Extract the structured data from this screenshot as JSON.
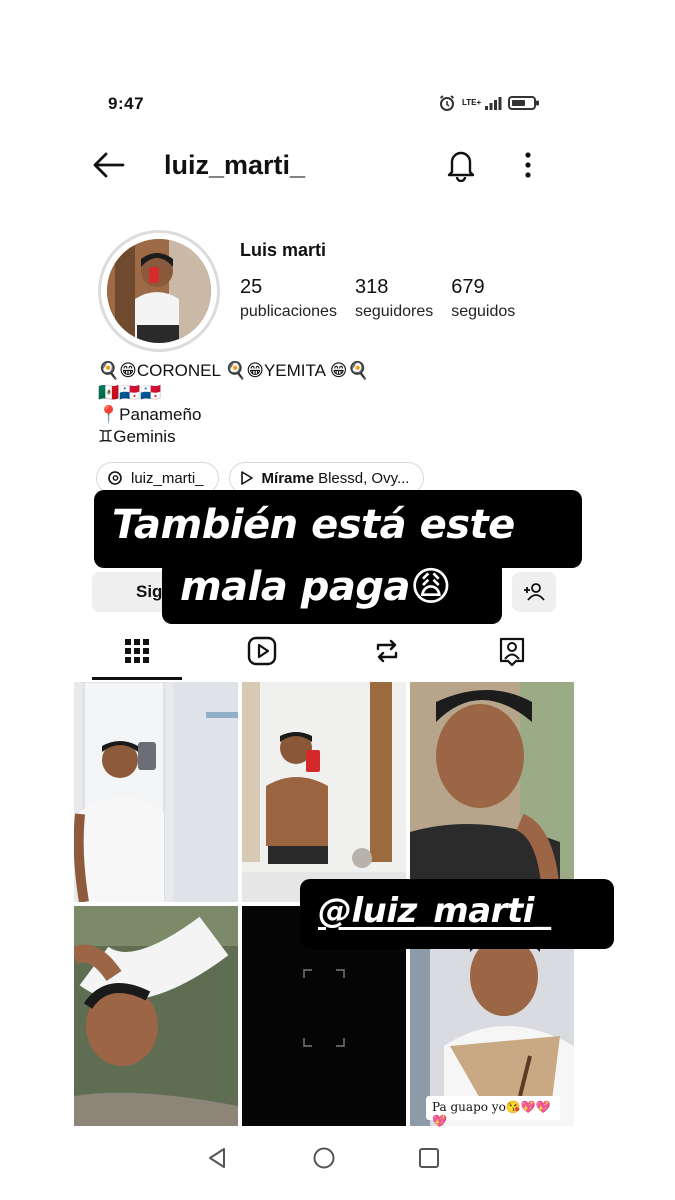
{
  "status_bar": {
    "time": "9:47",
    "network": "LTE+"
  },
  "header": {
    "username": "luiz_marti_"
  },
  "profile": {
    "name": "Luis marti",
    "stats": [
      {
        "value": "25",
        "label": "publicaciones"
      },
      {
        "value": "318",
        "label": "seguidores"
      },
      {
        "value": "679",
        "label": "seguidos"
      }
    ],
    "bio": {
      "line1": "🍳😁CORONEL 🍳😁YEMITA 😁🍳",
      "line2": "🇲🇽🇵🇦🇵🇦",
      "line3": "📍Panameño",
      "line4": "♊Geminis"
    }
  },
  "chips": {
    "threads_label": "luiz_marti_",
    "music_title": "Mírame",
    "music_artist": "Blessd, Ovy..."
  },
  "actions": {
    "follow_label": "Sig"
  },
  "tabs": [
    "grid",
    "reels",
    "reposts",
    "tagged"
  ],
  "overlay": {
    "caption_line1": "También está este",
    "caption_line2": "mala paga😩",
    "mention": "@luiz_marti_",
    "sticker": "Pa guapo yo😘💖💖💖"
  },
  "colors": {
    "caption_bg": "#000000",
    "caption_text": "#ffffff",
    "button_bg": "#efefef"
  }
}
